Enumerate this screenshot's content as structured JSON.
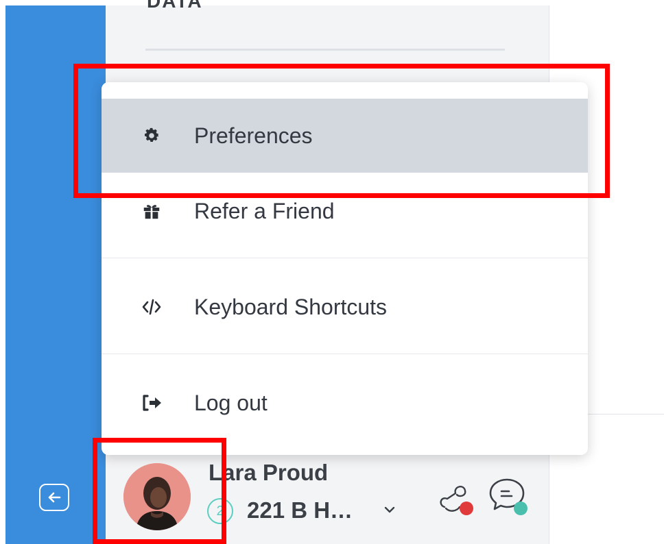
{
  "sidebar": {
    "section_label": "DATA"
  },
  "menu": {
    "items": [
      {
        "label": "Preferences",
        "icon": "gear-icon",
        "active": true
      },
      {
        "label": "Refer a Friend",
        "icon": "gift-icon",
        "active": false
      },
      {
        "label": "Keyboard Shortcuts",
        "icon": "code-icon",
        "active": false
      },
      {
        "label": "Log out",
        "icon": "logout-icon",
        "active": false
      }
    ]
  },
  "user": {
    "name": "Lara Proud",
    "org_number": "2",
    "org_name": "221 B H…"
  },
  "colors": {
    "rail": "#3a8cdc",
    "highlight": "#ff0000",
    "active_item": "#d3d8de",
    "teal": "#5ccfc0",
    "status_red": "#e03a3a"
  }
}
